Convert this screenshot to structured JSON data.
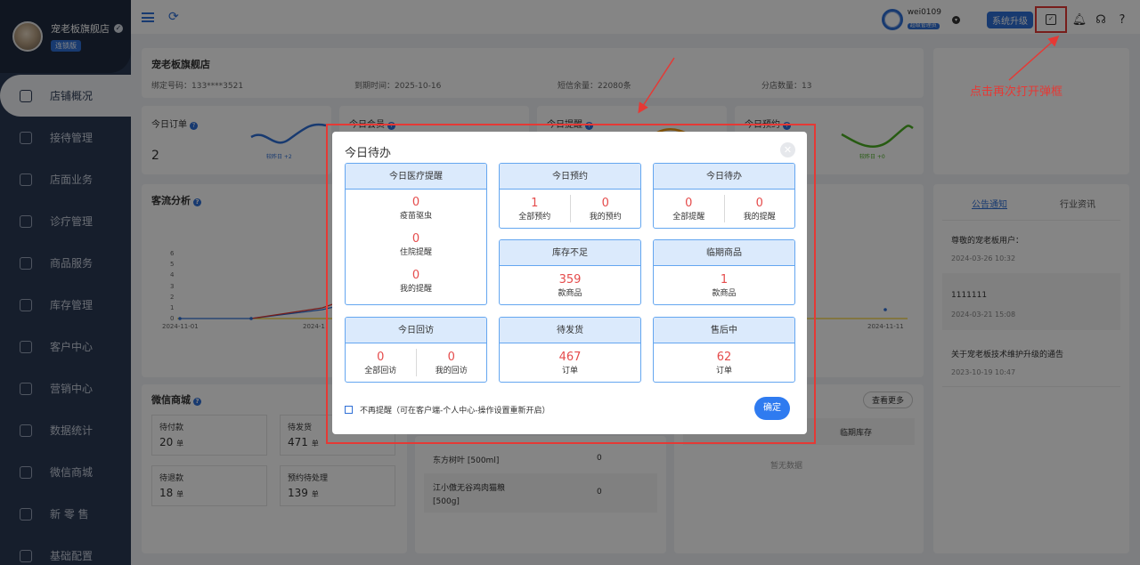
{
  "sidebar": {
    "store_name": "宠老板旗舰店",
    "store_badge": "连锁版",
    "items": [
      {
        "label": "店铺概况",
        "icon": "monitor-icon"
      },
      {
        "label": "接待管理",
        "icon": "reception-icon"
      },
      {
        "label": "店面业务",
        "icon": "home-icon"
      },
      {
        "label": "诊疗管理",
        "icon": "medical-icon"
      },
      {
        "label": "商品服务",
        "icon": "goods-icon"
      },
      {
        "label": "库存管理",
        "icon": "inventory-icon"
      },
      {
        "label": "客户中心",
        "icon": "customer-icon"
      },
      {
        "label": "营销中心",
        "icon": "marketing-icon"
      },
      {
        "label": "数据统计",
        "icon": "stats-icon"
      },
      {
        "label": "微信商城",
        "icon": "wechat-icon"
      },
      {
        "label": "新 零 售",
        "icon": "retail-icon"
      },
      {
        "label": "基础配置",
        "icon": "settings-icon"
      }
    ]
  },
  "topbar": {
    "user_name": "wei0109",
    "user_role": "超级管理员",
    "upgrade_label": "系统升级"
  },
  "store_card": {
    "title": "宠老板旗舰店",
    "phone": "绑定号码：133****3521",
    "expire": "到期时间：2025-10-16",
    "sms": "短信余量：22080条",
    "branches": "分店数量：13"
  },
  "stats": [
    {
      "title": "今日订单",
      "value": "2",
      "compare": "较昨日 +2"
    },
    {
      "title": "今日会员",
      "value": "",
      "compare": ""
    },
    {
      "title": "今日提醒",
      "value": "",
      "compare": ""
    },
    {
      "title": "今日预约",
      "value": "",
      "compare": "较昨日 +0"
    }
  ],
  "traffic": {
    "title": "客流分析",
    "y_ticks": [
      "6",
      "5",
      "4",
      "3",
      "2",
      "1",
      "0"
    ],
    "x_start": "2024-11-01",
    "x_mid": "2024-1",
    "x_end": "2024-11-11"
  },
  "wechat": {
    "title": "微信商城",
    "cells": [
      {
        "label": "待付款",
        "value": "20",
        "unit": "单"
      },
      {
        "label": "待发货",
        "value": "471",
        "unit": "单"
      },
      {
        "label": "待退款",
        "value": "18",
        "unit": "单"
      },
      {
        "label": "预约待处理",
        "value": "139",
        "unit": "单"
      }
    ]
  },
  "products": [
    {
      "name": "东方树叶 [500ml]",
      "qty": "0"
    },
    {
      "name": "江小傲无谷鸡肉猫粮 [500g]",
      "qty": "0"
    }
  ],
  "expiring": {
    "view_more": "查看更多",
    "col": "临期库存",
    "empty": "暂无数据"
  },
  "notice": {
    "tab_active": "公告通知",
    "tab_other": "行业资讯",
    "items": [
      {
        "title": "尊敬的宠老板用户：",
        "date": "2024-03-26 10:32"
      },
      {
        "title": "1111111",
        "date": "2024-03-21 15:08"
      },
      {
        "title": "关于宠老板技术维护升级的通告",
        "date": "2023-10-19 10:47"
      }
    ]
  },
  "annotation": "点击再次打开弹框",
  "modal": {
    "title": "今日待办",
    "medical": {
      "title": "今日医疗提醒",
      "rows": [
        {
          "value": "0",
          "label": "疫苗驱虫"
        },
        {
          "value": "0",
          "label": "住院提醒"
        },
        {
          "value": "0",
          "label": "我的提醒"
        }
      ]
    },
    "appointment": {
      "title": "今日预约",
      "left_value": "1",
      "left_label": "全部预约",
      "right_value": "0",
      "right_label": "我的预约"
    },
    "todo": {
      "title": "今日待办",
      "left_value": "0",
      "left_label": "全部提醒",
      "right_value": "0",
      "right_label": "我的提醒"
    },
    "stock": {
      "title": "库存不足",
      "value": "359",
      "label": "款商品"
    },
    "expiry": {
      "title": "临期商品",
      "value": "1",
      "label": "款商品"
    },
    "revisit": {
      "title": "今日回访",
      "left_value": "0",
      "left_label": "全部回访",
      "right_value": "0",
      "right_label": "我的回访"
    },
    "shipping": {
      "title": "待发货",
      "value": "467",
      "label": "订单"
    },
    "aftersale": {
      "title": "售后中",
      "value": "62",
      "label": "订单"
    },
    "no_remind": "不再提醒（可在客户端-个人中心-操作设置重新开启）",
    "confirm": "确定"
  },
  "colors": {
    "accent": "#2f6fd6",
    "highlight": "#e53935",
    "value_red": "#e54c4c",
    "sidebar": "#2b3a55"
  }
}
